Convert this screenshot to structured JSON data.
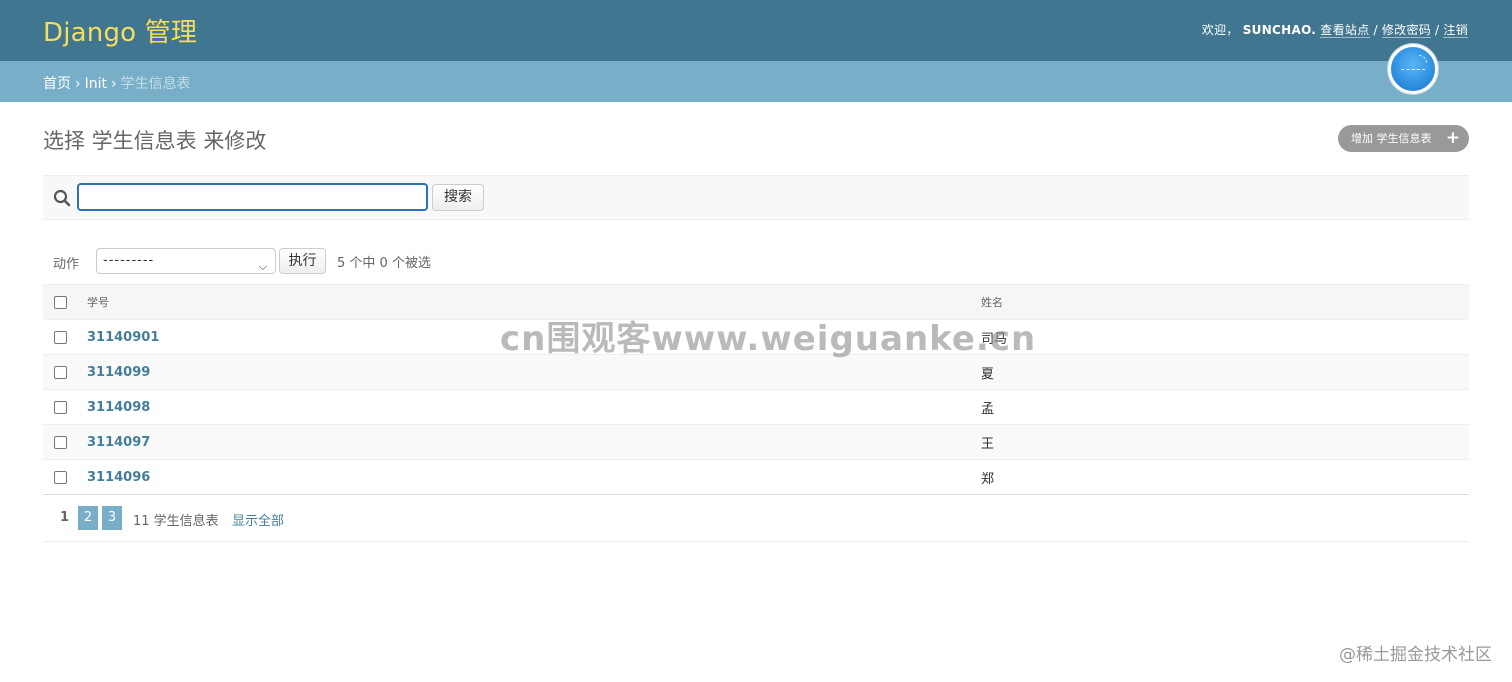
{
  "header": {
    "brand": "Django 管理",
    "welcome": "欢迎，",
    "username": "SUNCHAO.",
    "view_site": "查看站点",
    "change_password": "修改密码",
    "logout": "注销",
    "separator": "/"
  },
  "breadcrumbs": {
    "home": "首页",
    "app": "Init",
    "current": "学生信息表",
    "separator": "›"
  },
  "main": {
    "title": "选择 学生信息表 来修改",
    "add_button": "增加 学生信息表"
  },
  "search": {
    "value": "",
    "placeholder": "",
    "button": "搜索"
  },
  "actions": {
    "label": "动作",
    "selected_option": "---------",
    "go_button": "执行",
    "counter": "5 个中 0 个被选"
  },
  "table": {
    "columns": [
      "学号",
      "姓名"
    ],
    "rows": [
      {
        "id": "31140901",
        "name": "司马"
      },
      {
        "id": "3114099",
        "name": "夏"
      },
      {
        "id": "3114098",
        "name": "孟"
      },
      {
        "id": "3114097",
        "name": "王"
      },
      {
        "id": "3114096",
        "name": "郑"
      }
    ]
  },
  "paginator": {
    "current_page": "1",
    "pages": [
      "2",
      "3"
    ],
    "total": "11 学生信息表",
    "show_all": "显示全部"
  },
  "watermarks": {
    "center": "cn围观客www.weiguanke.cn",
    "corner": "@稀土掘金技术社区"
  },
  "colors": {
    "header_bg": "#417690",
    "brand_text": "#f5dd5d",
    "breadcrumb_bg": "#79aec8",
    "link": "#447e9b",
    "add_button_bg": "#999999"
  },
  "icons": {
    "search": "search-icon",
    "add": "plus-icon",
    "dropdown": "chevron-down-icon"
  }
}
